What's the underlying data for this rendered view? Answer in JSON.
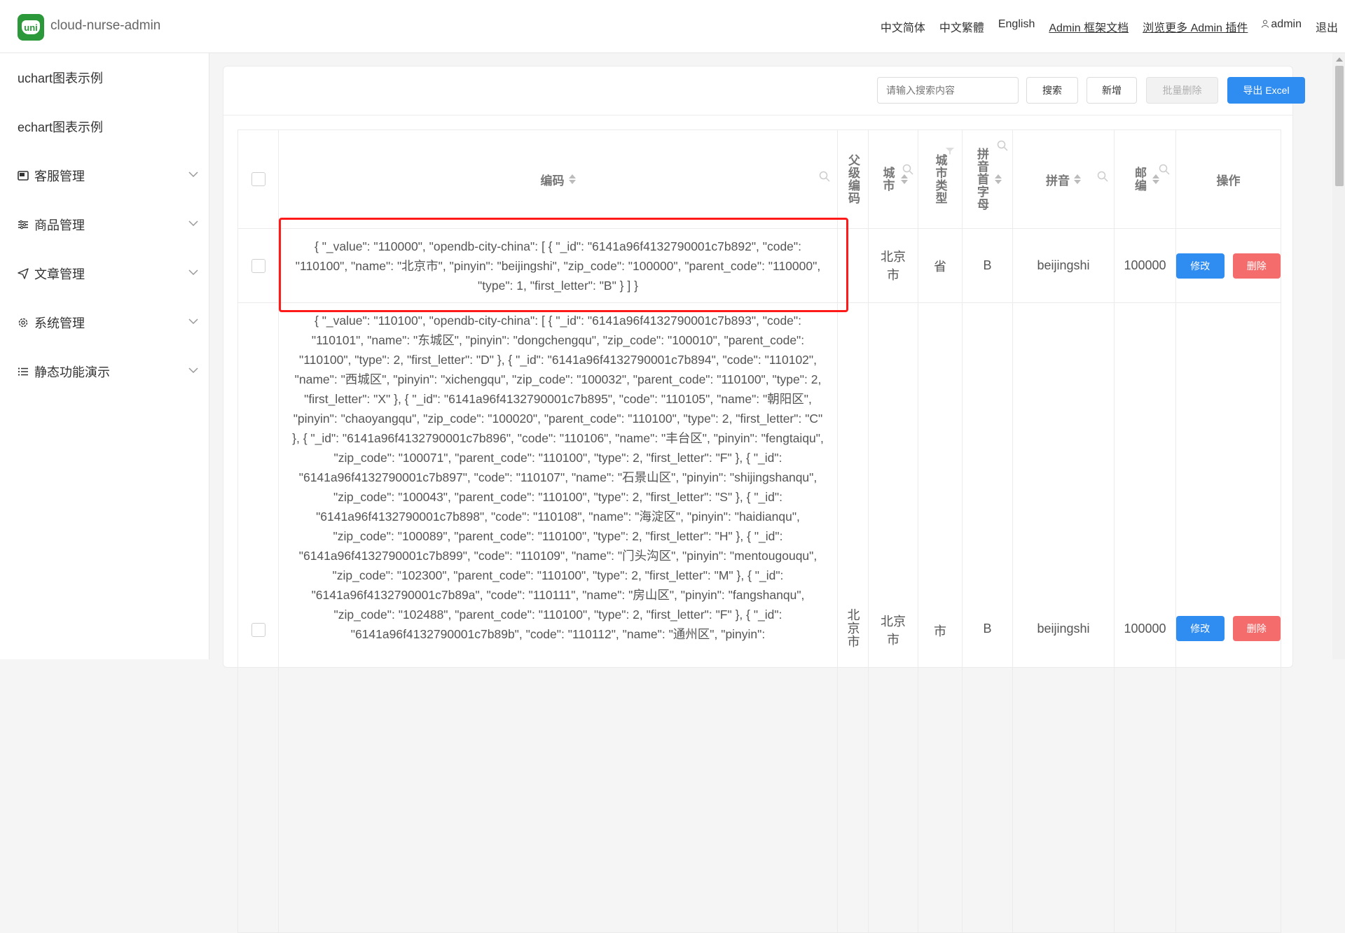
{
  "header": {
    "app_title": "cloud-nurse-admin",
    "logo_text": "uni",
    "nav": [
      "中文简体",
      "中文繁體",
      "English",
      "Admin 框架文档",
      "浏览更多 Admin 插件",
      "admin",
      "退出"
    ]
  },
  "sidebar": {
    "items": [
      {
        "label": "uchart图表示例",
        "icon": ""
      },
      {
        "label": "echart图表示例",
        "icon": ""
      },
      {
        "label": "客服管理",
        "icon": "image-icon"
      },
      {
        "label": "商品管理",
        "icon": "sliders-icon"
      },
      {
        "label": "文章管理",
        "icon": "send-icon"
      },
      {
        "label": "系统管理",
        "icon": "gear-icon"
      },
      {
        "label": "静态功能演示",
        "icon": "list-icon"
      }
    ]
  },
  "toolbar": {
    "search_placeholder": "请输入搜索内容",
    "search_label": "搜索",
    "add_label": "新增",
    "batch_delete_label": "批量删除",
    "export_label": "导出 Excel"
  },
  "table": {
    "headers": [
      "编码",
      "父级编码",
      "城市",
      "城市类型",
      "拼音首字母",
      "拼音",
      "邮编",
      "操作"
    ],
    "rows": [
      {
        "code": "{ \"_value\": \"110000\", \"opendb-city-china\": [ { \"_id\": \"6141a96f4132790001c7b892\", \"code\": \"110100\", \"name\": \"北京市\", \"pinyin\": \"beijingshi\", \"zip_code\": \"100000\", \"parent_code\": \"110000\", \"type\": 1, \"first_letter\": \"B\" } ] }",
        "parent_code": "",
        "city": "北京市",
        "city_type": "省",
        "first_letter": "B",
        "pinyin": "beijingshi",
        "zip": "100000",
        "edit": "修改",
        "delete": "删除"
      },
      {
        "code": "{ \"_value\": \"110100\", \"opendb-city-china\": [ { \"_id\": \"6141a96f4132790001c7b893\", \"code\": \"110101\", \"name\": \"东城区\", \"pinyin\": \"dongchengqu\", \"zip_code\": \"100010\", \"parent_code\": \"110100\", \"type\": 2, \"first_letter\": \"D\" }, { \"_id\": \"6141a96f4132790001c7b894\", \"code\": \"110102\", \"name\": \"西城区\", \"pinyin\": \"xichengqu\", \"zip_code\": \"100032\", \"parent_code\": \"110100\", \"type\": 2, \"first_letter\": \"X\" }, { \"_id\": \"6141a96f4132790001c7b895\", \"code\": \"110105\", \"name\": \"朝阳区\", \"pinyin\": \"chaoyangqu\", \"zip_code\": \"100020\", \"parent_code\": \"110100\", \"type\": 2, \"first_letter\": \"C\" }, { \"_id\": \"6141a96f4132790001c7b896\", \"code\": \"110106\", \"name\": \"丰台区\", \"pinyin\": \"fengtaiqu\", \"zip_code\": \"100071\", \"parent_code\": \"110100\", \"type\": 2, \"first_letter\": \"F\" }, { \"_id\": \"6141a96f4132790001c7b897\", \"code\": \"110107\", \"name\": \"石景山区\", \"pinyin\": \"shijingshanqu\", \"zip_code\": \"100043\", \"parent_code\": \"110100\", \"type\": 2, \"first_letter\": \"S\" }, { \"_id\": \"6141a96f4132790001c7b898\", \"code\": \"110108\", \"name\": \"海淀区\", \"pinyin\": \"haidianqu\", \"zip_code\": \"100089\", \"parent_code\": \"110100\", \"type\": 2, \"first_letter\": \"H\" }, { \"_id\": \"6141a96f4132790001c7b899\", \"code\": \"110109\", \"name\": \"门头沟区\", \"pinyin\": \"mentougouqu\", \"zip_code\": \"102300\", \"parent_code\": \"110100\", \"type\": 2, \"first_letter\": \"M\" }, { \"_id\": \"6141a96f4132790001c7b89a\", \"code\": \"110111\", \"name\": \"房山区\", \"pinyin\": \"fangshanqu\", \"zip_code\": \"102488\", \"parent_code\": \"110100\", \"type\": 2, \"first_letter\": \"F\" }, { \"_id\": \"6141a96f4132790001c7b89b\", \"code\": \"110112\", \"name\": \"通州区\", \"pinyin\":",
        "parent_code": "北京市",
        "city": "北京市",
        "city_type": "市",
        "first_letter": "B",
        "pinyin": "beijingshi",
        "zip": "100000",
        "edit": "修改",
        "delete": "删除"
      }
    ]
  },
  "colors": {
    "primary": "#2f8cf0",
    "danger": "#f56c6c",
    "logo_green": "#2b9939",
    "highlight": "#ff1a1a"
  }
}
